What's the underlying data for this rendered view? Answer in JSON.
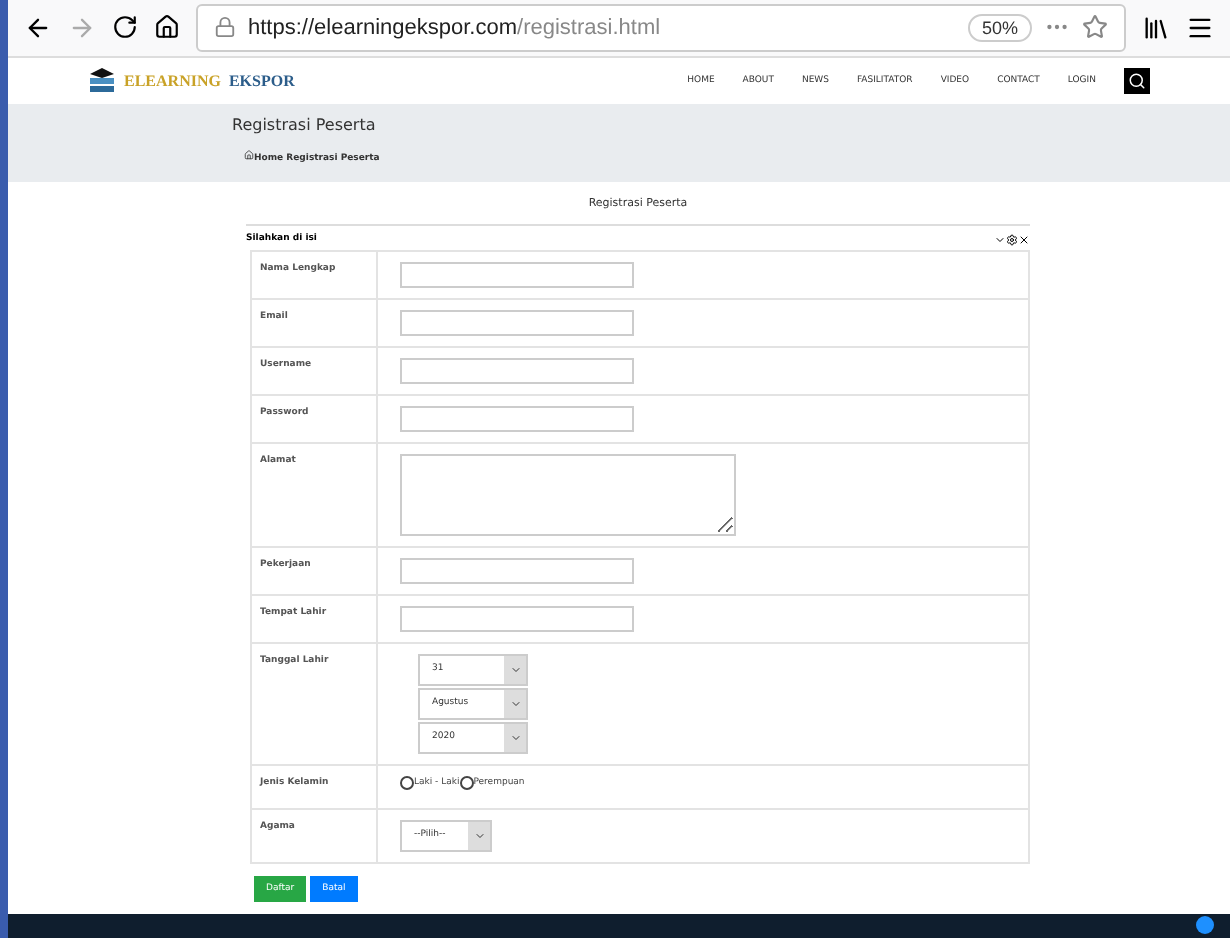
{
  "browser": {
    "url_host": "https://elearningekspor.com",
    "url_path": "/registrasi.html",
    "zoom": "50%"
  },
  "site": {
    "logo_first": "ELEARNING",
    "logo_second": "EKSPOR",
    "nav": [
      "HOME",
      "ABOUT",
      "NEWS",
      "FASILITATOR",
      "VIDEO",
      "CONTACT"
    ],
    "login": "LOGIN"
  },
  "page_header": {
    "title": "Registrasi Peserta",
    "breadcrumb": "Home Registrasi Peserta"
  },
  "form_title": "Registrasi Peserta",
  "panel": {
    "title": "Silahkan di isi",
    "fields": [
      {
        "kind": "text",
        "label": "Nama Lengkap"
      },
      {
        "kind": "text",
        "label": "Email"
      },
      {
        "kind": "text",
        "label": "Username"
      },
      {
        "kind": "text",
        "label": "Password"
      },
      {
        "kind": "textarea",
        "label": "Alamat"
      },
      {
        "kind": "text",
        "label": "Pekerjaan"
      },
      {
        "kind": "text",
        "label": "Tempat Lahir"
      },
      {
        "kind": "date",
        "label": "Tanggal Lahir",
        "values": [
          "31",
          "Agustus",
          "2020"
        ]
      },
      {
        "kind": "radio",
        "label": "Jenis Kelamin",
        "options": [
          {
            "label": "Laki - Laki",
            "selected": false
          },
          {
            "label": "Perempuan",
            "selected": false
          }
        ]
      },
      {
        "kind": "select",
        "label": "Agama",
        "values": [
          "--Pilih--"
        ]
      }
    ]
  },
  "buttons": [
    {
      "label": "Daftar",
      "color": "#28a745"
    },
    {
      "label": "Batal",
      "color": "#007bff"
    }
  ]
}
